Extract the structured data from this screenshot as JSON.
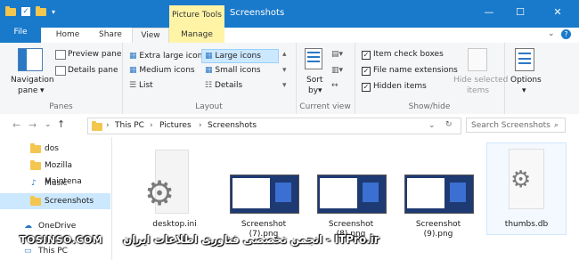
{
  "window": {
    "title": "Screenshots",
    "context_tab": "Picture Tools",
    "accent": "#1979ca",
    "context_color": "#fff3a6"
  },
  "tabs": {
    "file": "File",
    "home": "Home",
    "share": "Share",
    "view": "View",
    "manage": "Manage"
  },
  "ribbon": {
    "panes": {
      "navigation_pane": "Navigation",
      "navigation_pane2": "pane",
      "preview_pane": "Preview pane",
      "details_pane": "Details pane",
      "label": "Panes"
    },
    "layout": {
      "extra_large": "Extra large icons",
      "large": "Large icons",
      "medium": "Medium icons",
      "small": "Small icons",
      "list": "List",
      "details": "Details",
      "label": "Layout"
    },
    "current_view": {
      "sort_by": "Sort",
      "sort_by2": "by",
      "label": "Current view"
    },
    "show_hide": {
      "item_checkboxes": "Item check boxes",
      "file_name_extensions": "File name extensions",
      "hidden_items": "Hidden items",
      "hide_selected": "Hide selected",
      "hide_selected2": "items",
      "label": "Show/hide"
    },
    "options": "Options"
  },
  "address": {
    "crumbs": [
      "This PC",
      "Pictures",
      "Screenshots"
    ],
    "search_placeholder": "Search Screenshots"
  },
  "nav_pane": [
    {
      "label": "dos",
      "icon": "folder-icon"
    },
    {
      "label": "Mozilla Maintena",
      "icon": "folder-icon"
    },
    {
      "label": "Music",
      "icon": "music-folder-icon"
    },
    {
      "label": "Screenshots",
      "icon": "folder-icon",
      "selected": true
    },
    {
      "label": "OneDrive",
      "icon": "onedrive-icon"
    },
    {
      "label": "This PC",
      "icon": "pc-icon"
    }
  ],
  "files": [
    {
      "name": "desktop.ini",
      "name2": ""
    },
    {
      "name": "Screenshot",
      "name2": "(7).png"
    },
    {
      "name": "Screenshot",
      "name2": "(8).png"
    },
    {
      "name": "Screenshot",
      "name2": "(9).png"
    },
    {
      "name": "thumbs.db",
      "name2": ""
    }
  ],
  "watermarks": {
    "left": "TOSINSO.COM",
    "right": "انجمن تخصصی فناوری اطلاعات ایران - ITPro.ir"
  }
}
